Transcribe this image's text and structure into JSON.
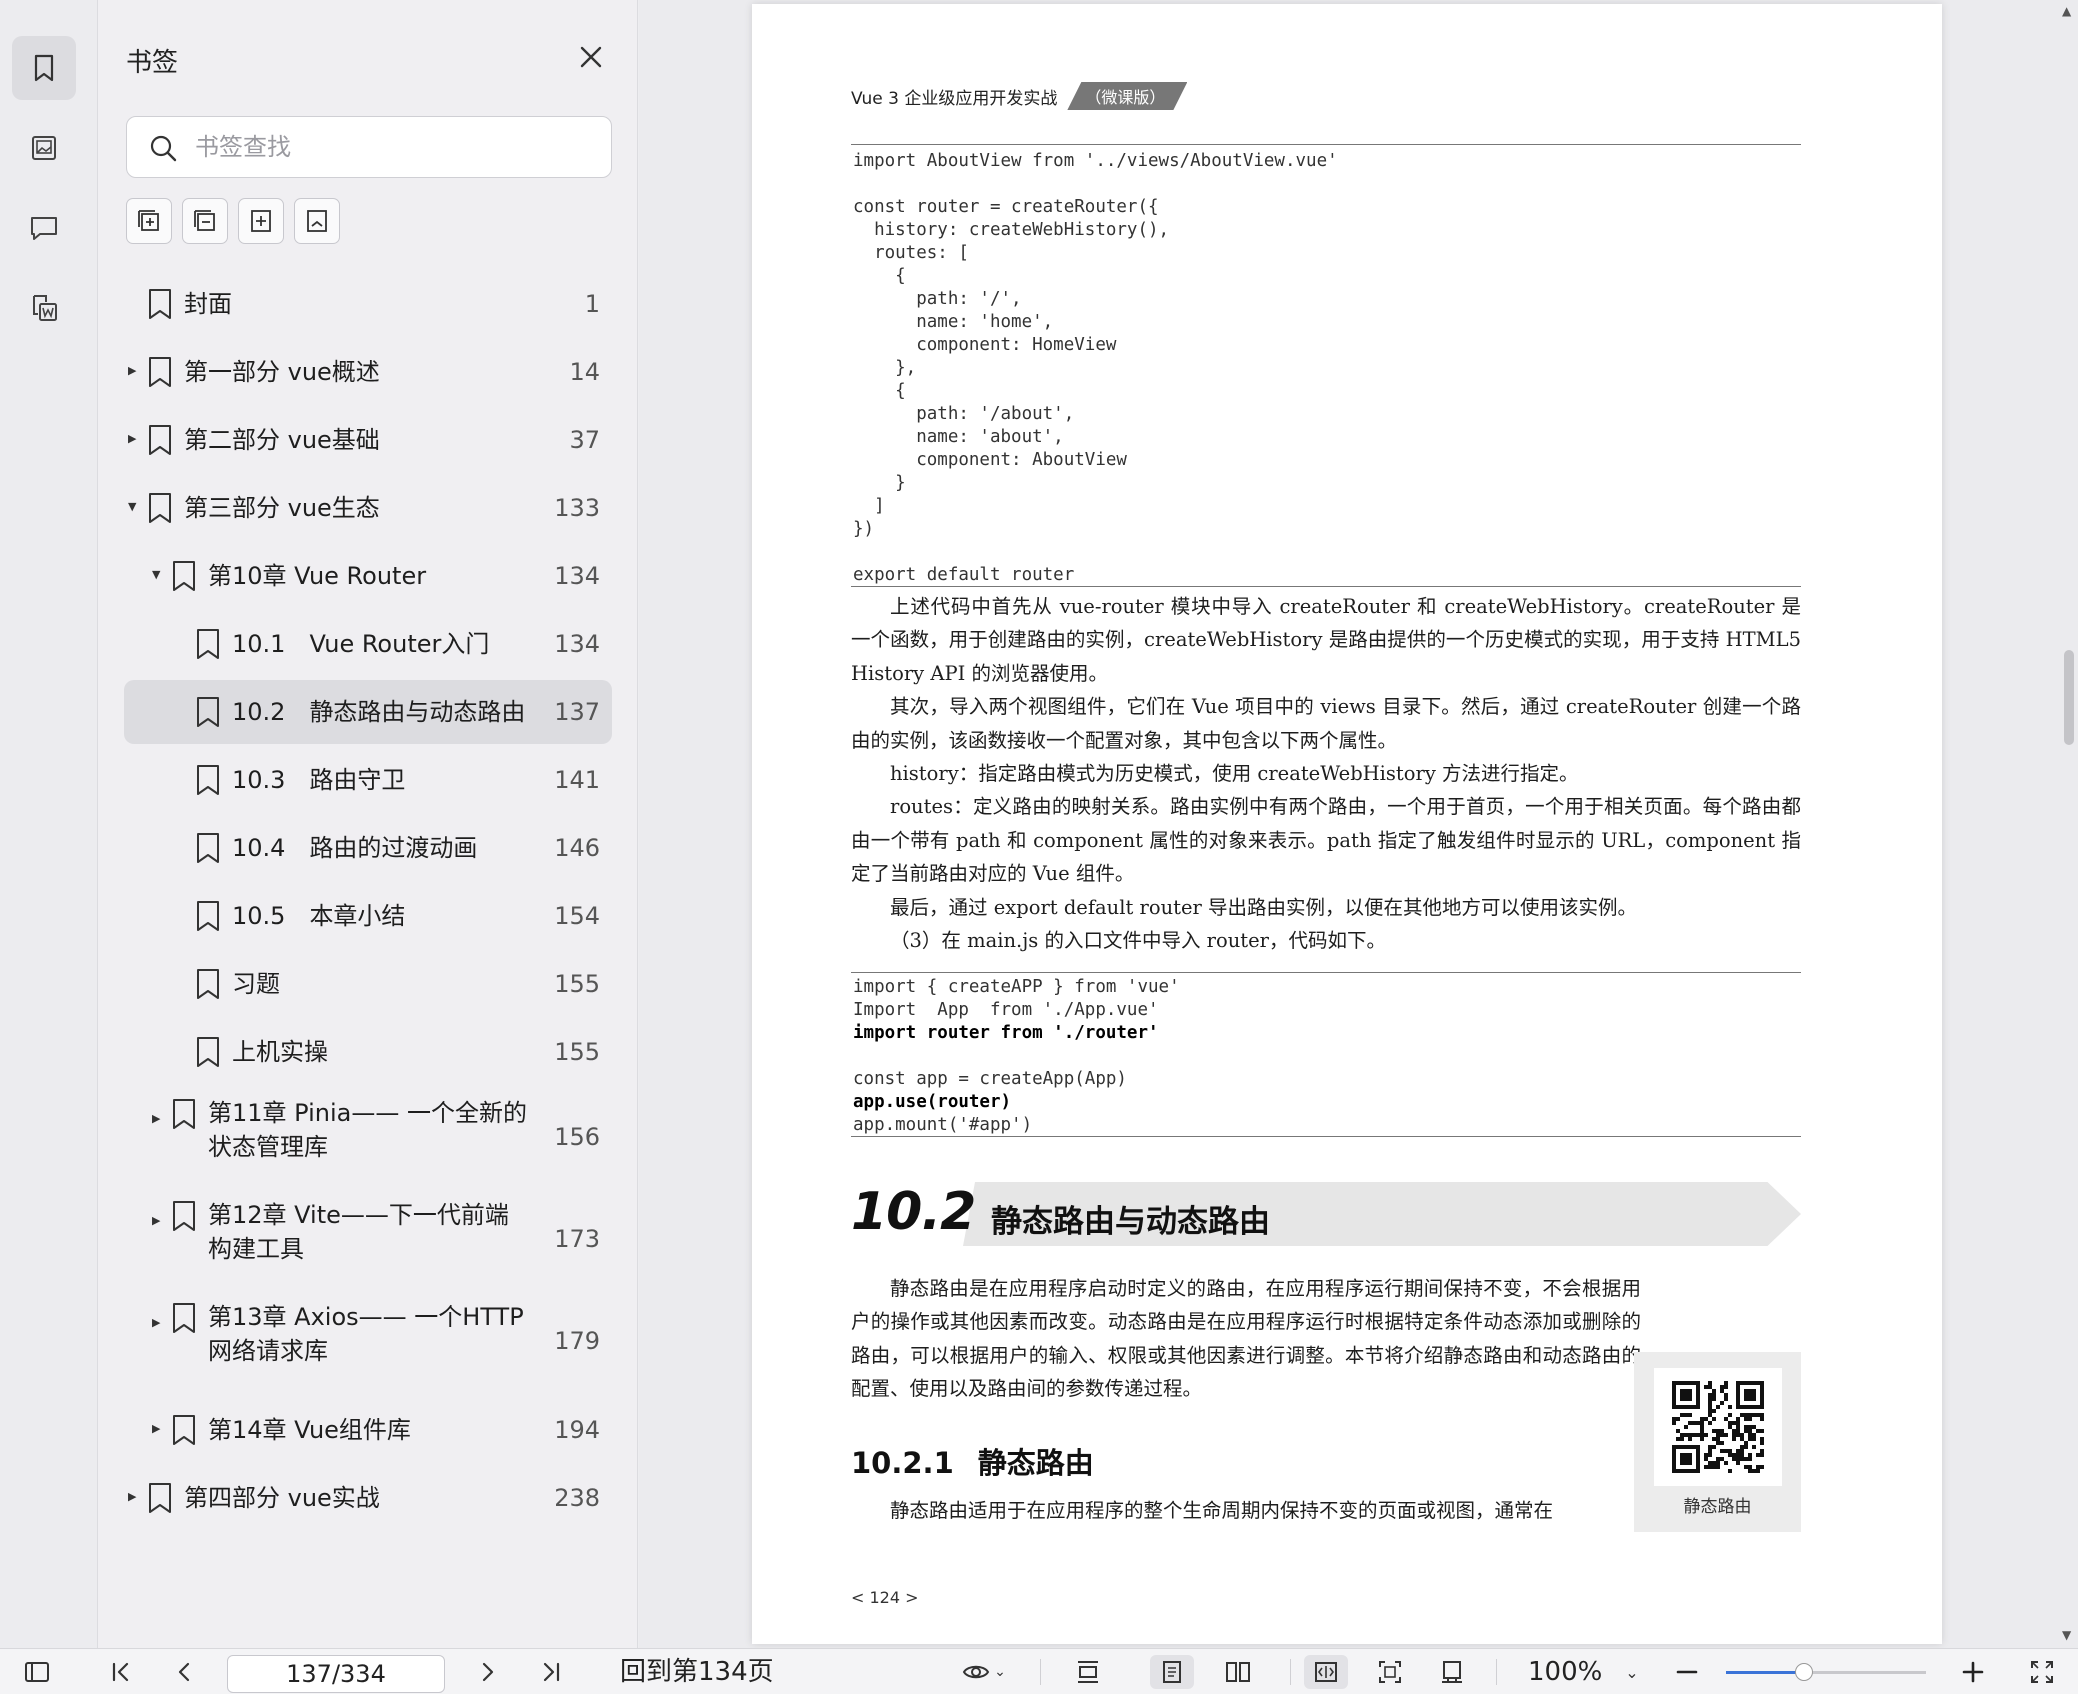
{
  "rail": {
    "items": [
      {
        "icon": "bookmark-icon",
        "active": true
      },
      {
        "icon": "image-icon",
        "active": false
      },
      {
        "icon": "comment-icon",
        "active": false
      },
      {
        "icon": "word-convert-icon",
        "active": false
      }
    ]
  },
  "sidebar": {
    "title": "书签",
    "search_placeholder": "书签查找",
    "tools": [
      "expand-all-icon",
      "collapse-all-icon",
      "add-bookmark-icon",
      "bookmark-outline-icon"
    ],
    "bookmarks": [
      {
        "label": "封面",
        "page": "1",
        "level": 0,
        "arrow": "none"
      },
      {
        "label": "第一部分 vue概述",
        "page": "14",
        "level": 0,
        "arrow": "collapsed"
      },
      {
        "label": "第二部分 vue基础",
        "page": "37",
        "level": 0,
        "arrow": "collapsed"
      },
      {
        "label": "第三部分 vue生态",
        "page": "133",
        "level": 0,
        "arrow": "expanded"
      },
      {
        "label": "第10章 Vue Router",
        "page": "134",
        "level": 1,
        "arrow": "expanded"
      },
      {
        "label": "10.1 Vue Router入门",
        "page": "134",
        "level": 2,
        "arrow": "none"
      },
      {
        "label": "10.2 静态路由与动态路由",
        "page": "137",
        "level": 2,
        "arrow": "none",
        "selected": true
      },
      {
        "label": "10.3 路由守卫",
        "page": "141",
        "level": 2,
        "arrow": "none"
      },
      {
        "label": "10.4 路由的过渡动画",
        "page": "146",
        "level": 2,
        "arrow": "none"
      },
      {
        "label": "10.5 本章小结",
        "page": "154",
        "level": 2,
        "arrow": "none"
      },
      {
        "label": "习题",
        "page": "155",
        "level": 2,
        "arrow": "none"
      },
      {
        "label": "上机实操",
        "page": "155",
        "level": 2,
        "arrow": "none"
      },
      {
        "label": "第11章 Pinia—— 一个全新的状态管理库",
        "page": "156",
        "level": 1,
        "arrow": "collapsed",
        "two_line": true
      },
      {
        "label": "第12章 Vite——下一代前端构建工具",
        "page": "173",
        "level": 1,
        "arrow": "collapsed",
        "two_line": true
      },
      {
        "label": "第13章 Axios—— 一个HTTP网络请求库",
        "page": "179",
        "level": 1,
        "arrow": "collapsed",
        "two_line": true
      },
      {
        "label": "第14章 Vue组件库",
        "page": "194",
        "level": 1,
        "arrow": "collapsed"
      },
      {
        "label": "第四部分 vue实战",
        "page": "238",
        "level": 0,
        "arrow": "collapsed"
      }
    ]
  },
  "doc": {
    "header_book": "Vue 3 企业级应用开发实战",
    "header_tag": "（微课版）",
    "code1": [
      "import AboutView from '../views/AboutView.vue'",
      "",
      "const router = createRouter({",
      "  history: createWebHistory(),",
      "  routes: [",
      "    {",
      "      path: '/',",
      "      name: 'home',",
      "      component: HomeView",
      "    },",
      "    {",
      "      path: '/about',",
      "      name: 'about',",
      "      component: AboutView",
      "    }",
      "  ]",
      "})",
      "",
      "export default router"
    ],
    "paragraphs": [
      "上述代码中首先从 vue-router 模块中导入 createRouter 和 createWebHistory。createRouter 是一个函数，用于创建路由的实例，createWebHistory 是路由提供的一个历史模式的实现，用于支持 HTML5 History API 的浏览器使用。",
      "其次，导入两个视图组件，它们在 Vue 项目中的 views 目录下。然后，通过 createRouter 创建一个路由的实例，该函数接收一个配置对象，其中包含以下两个属性。",
      "history：指定路由模式为历史模式，使用 createWebHistory 方法进行指定。",
      "routes：定义路由的映射关系。路由实例中有两个路由，一个用于首页，一个用于相关页面。每个路由都由一个带有 path 和 component 属性的对象来表示。path 指定了触发组件时显示的 URL，component 指定了当前路由对应的 Vue 组件。",
      "最后，通过 export default router 导出路由实例，以便在其他地方可以使用该实例。",
      "（3）在 main.js 的入口文件中导入 router，代码如下。"
    ],
    "code2": [
      {
        "text": "import { createAPP } from 'vue'",
        "bold": false
      },
      {
        "text": "Import  App  from './App.vue'",
        "bold": false
      },
      {
        "text": "import router from './router'",
        "bold": true
      },
      {
        "text": "",
        "bold": false
      },
      {
        "text": "const app = createApp(App)",
        "bold": false
      },
      {
        "text": "app.use(router)",
        "bold": true
      },
      {
        "text": "app.mount('#app')",
        "bold": false
      }
    ],
    "section_num": "10.2",
    "section_title": "静态路由与动态路由",
    "section_para": "静态路由是在应用程序启动时定义的路由，在应用程序运行期间保持不变，不会根据用户的操作或其他因素而改变。动态路由是在应用程序运行时根据特定条件动态添加或删除的路由，可以根据用户的输入、权限或其他因素进行调整。本节将介绍静态路由和动态路由的配置、使用以及路由间的参数传递过程。",
    "sub_num": "10.2.1",
    "sub_title": "静态路由",
    "sub_para": "静态路由适用于在应用程序的整个生命周期内保持不变的页面或视图，通常在",
    "qr_caption": "静态路由",
    "page_footer": "< 124 >"
  },
  "toolbar": {
    "page_indicator": "137/334",
    "back_link": "回到第134页",
    "zoom": "100%",
    "zoom_fraction": 0.39
  }
}
